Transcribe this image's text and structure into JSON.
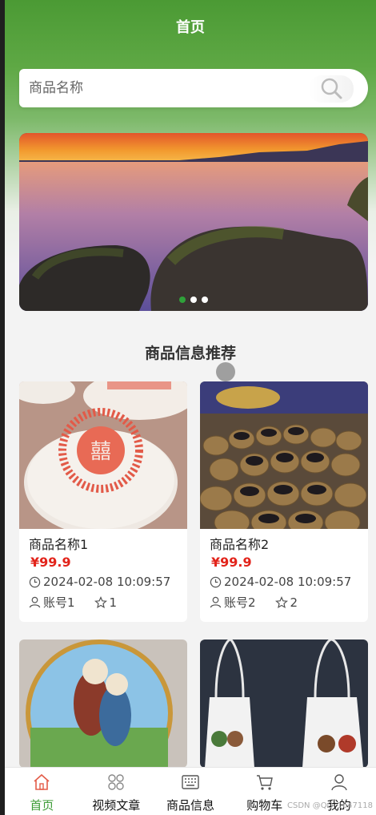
{
  "header": {
    "title": "首页"
  },
  "search": {
    "placeholder": "商品名称"
  },
  "banner": {
    "dots": 3,
    "active_dot": 0
  },
  "section": {
    "title": "商品信息推荐"
  },
  "products": [
    {
      "name": "商品名称1",
      "price": "¥99.9",
      "time": "2024-02-08 10:09:57",
      "account": "账号1",
      "favorites": "1"
    },
    {
      "name": "商品名称2",
      "price": "¥99.9",
      "time": "2024-02-08 10:09:57",
      "account": "账号2",
      "favorites": "2"
    }
  ],
  "tabbar": {
    "items": [
      {
        "label": "首页",
        "icon": "home-icon",
        "active": true
      },
      {
        "label": "视频文章",
        "icon": "grid-icon",
        "active": false
      },
      {
        "label": "商品信息",
        "icon": "keyboard-icon",
        "active": false
      },
      {
        "label": "购物车",
        "icon": "cart-icon",
        "active": false
      },
      {
        "label": "我的",
        "icon": "user-icon",
        "active": false
      }
    ]
  },
  "watermark": "CSDN @QQ_1647118",
  "colors": {
    "accent": "#3c9b36",
    "header_green": "#4b9a34",
    "price": "#e2231a"
  }
}
